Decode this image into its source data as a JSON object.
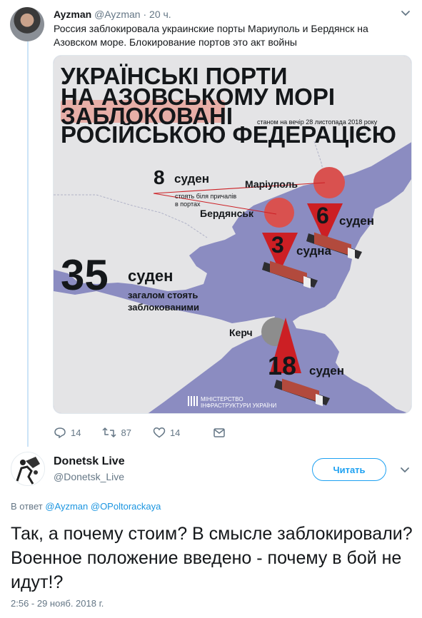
{
  "tweet1": {
    "author_name": "Ayzman",
    "author_handle": "@Ayzman",
    "separator": "·",
    "time": "20 ч.",
    "text": "Россия заблокировала украинские порты Мариуполь и Бердянск на Азовском море. Блокирование портов это акт войны",
    "counts": {
      "replies": "14",
      "retweets": "87",
      "likes": "14"
    },
    "image": {
      "title_lines": [
        "УКРАЇНСЬКІ ПОРТИ",
        "НА АЗОВСЬКОМУ МОРІ",
        "ЗАБЛОКОВАНІ",
        "РОСІЙСЬКОЮ ФЕДЕРАЦІЄЮ"
      ],
      "date_note": "станом на вечір 28 листопада 2018 року",
      "count_8": "8",
      "label_8": "суден",
      "note_8_line1": "стоять біля причалів",
      "note_8_line2": "в портах",
      "city_mariupol": "Маріуполь",
      "city_berdyansk": "Бердянськ",
      "city_kerch": "Керч",
      "count_6": "6",
      "label_6": "суден",
      "count_3": "3",
      "label_3": "судна",
      "count_35": "35",
      "label_35": "суден",
      "sub_35_line1": "загалом стоять",
      "sub_35_line2": "заблокованими",
      "count_18": "18",
      "label_18": "суден",
      "ministry_line1": "МІНІСТЕРСТВО",
      "ministry_line2": "ІНФРАСТРУКТУРИ УКРАЇНИ",
      "colors": {
        "sea": "#8b8cc1",
        "land": "#e4e4e6",
        "accent": "#cc1f24",
        "circle": "#d9514f"
      }
    }
  },
  "tweet2": {
    "author_name": "Donetsk Live",
    "author_handle": "@Donetsk_Live",
    "follow_label": "Читать",
    "reply_prefix": "В ответ",
    "reply_mention1": "@Ayzman",
    "reply_mention2": "@OPoltorackaya",
    "text": "Так, а почему стоим? В смысле заблокировали? Военное положение введено - почему в бой не идут!?",
    "timestamp": "2:56 - 29 нояб. 2018 г."
  },
  "colors": {
    "link": "#1b95e0",
    "muted": "#657786",
    "thread_line": "#cce4f7"
  }
}
